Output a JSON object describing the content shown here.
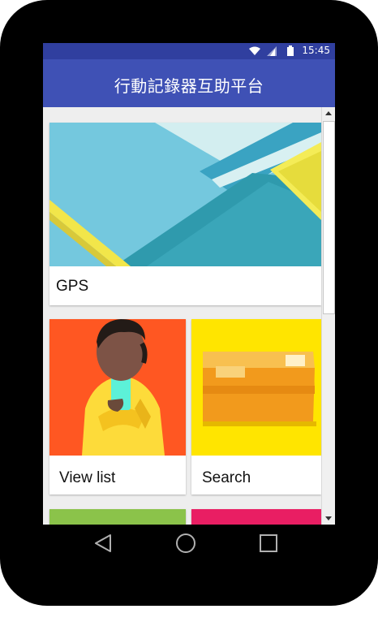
{
  "status_bar": {
    "time": "15:45",
    "icons": [
      "wifi-icon",
      "signal-icon",
      "battery-icon"
    ]
  },
  "app_bar": {
    "title": "行動記錄器互助平台"
  },
  "cards": [
    {
      "label": "GPS"
    },
    {
      "label": "View list"
    },
    {
      "label": "Search"
    }
  ],
  "nav_bar": {
    "buttons": [
      "back-icon",
      "home-icon",
      "recents-icon"
    ]
  },
  "colors": {
    "primary": "#3f51b5",
    "primary_dark": "#303f9f",
    "peek_green": "#8bc34a",
    "peek_pink": "#e91e63"
  }
}
